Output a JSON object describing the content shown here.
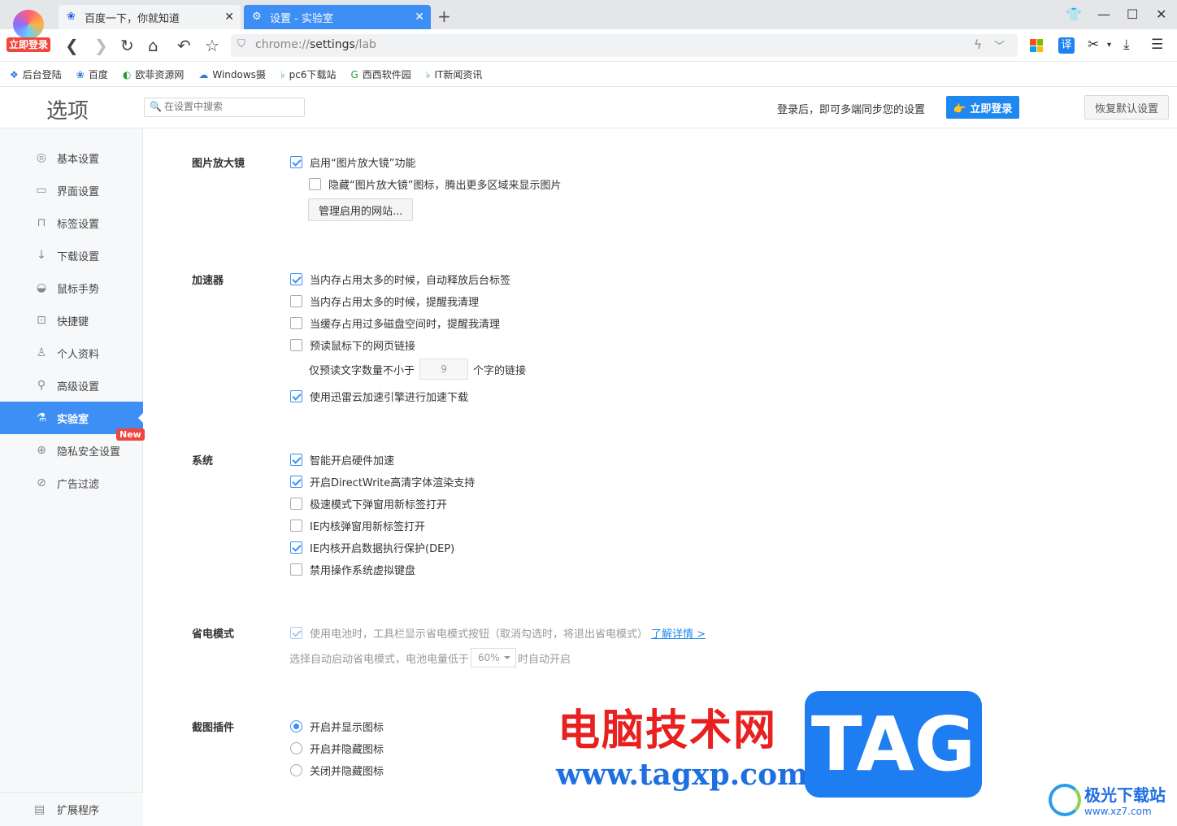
{
  "browser": {
    "login_badge": "立即登录",
    "tabs": [
      {
        "title": "百度一下，你就知道",
        "active": false
      },
      {
        "title": "设置 - 实验室",
        "active": true
      }
    ],
    "address": {
      "scheme": "chrome://",
      "host": "settings",
      "path": "/lab"
    },
    "bookmarks": [
      "后台登陆",
      "百度",
      "欧菲资源网",
      "Windows摄",
      "pc6下载站",
      "西西软件园",
      "IT新闻资讯"
    ],
    "accent_color": "#3d8ef5"
  },
  "header": {
    "title": "选项",
    "search_placeholder": "在设置中搜索",
    "login_hint": "登录后，即可多端同步您的设置",
    "login_button": "立即登录",
    "restore_button": "恢复默认设置"
  },
  "sidebar": {
    "items": [
      {
        "label": "基本设置",
        "icon": "gear-icon"
      },
      {
        "label": "界面设置",
        "icon": "window-icon"
      },
      {
        "label": "标签设置",
        "icon": "tab-icon"
      },
      {
        "label": "下载设置",
        "icon": "download-icon"
      },
      {
        "label": "鼠标手势",
        "icon": "mouse-icon"
      },
      {
        "label": "快捷键",
        "icon": "keyboard-icon"
      },
      {
        "label": "个人资料",
        "icon": "user-icon"
      },
      {
        "label": "高级设置",
        "icon": "wrench-icon"
      },
      {
        "label": "实验室",
        "icon": "flask-icon",
        "active": true
      },
      {
        "label": "隐私安全设置",
        "icon": "shield-icon"
      },
      {
        "label": "广告过滤",
        "icon": "block-icon"
      }
    ],
    "new_badge": "New",
    "extensions": "扩展程序"
  },
  "sections": {
    "magnifier": {
      "title": "图片放大镜",
      "opt1": "启用“图片放大镜”功能",
      "opt2": "隐藏“图片放大镜”图标，腾出更多区域来显示图片",
      "manage_button": "管理启用的网站..."
    },
    "accelerator": {
      "title": "加速器",
      "opt1": "当内存占用太多的时候，自动释放后台标签",
      "opt2": "当内存占用太多的时候，提醒我清理",
      "opt3": "当缓存占用过多磁盘空间时，提醒我清理",
      "opt4": "预读鼠标下的网页链接",
      "prefetch_prefix": "仅预读文字数量不小于",
      "prefetch_value": "9",
      "prefetch_suffix": "个字的链接",
      "opt5": "使用迅雷云加速引擎进行加速下载"
    },
    "system": {
      "title": "系统",
      "opt1": "智能开启硬件加速",
      "opt2": "开启DirectWrite高清字体渲染支持",
      "opt3": "极速模式下弹窗用新标签打开",
      "opt4": "IE内核弹窗用新标签打开",
      "opt5": "IE内核开启数据执行保护(DEP)",
      "opt6": "禁用操作系统虚拟键盘"
    },
    "power": {
      "title": "省电模式",
      "opt1": "使用电池时，工具栏显示省电模式按钮（取消勾选时，将退出省电模式）",
      "link": "了解详情 >",
      "auto_prefix": "选择自动启动省电模式，电池电量低于",
      "auto_value": "60%",
      "auto_suffix": "时自动开启"
    },
    "screenshot": {
      "title": "截图插件",
      "opt1": "开启并显示图标",
      "opt2": "开启并隐藏图标",
      "opt3": "关闭并隐藏图标"
    }
  },
  "watermark": {
    "cn": "电脑技术网",
    "url": "www.tagxp.com",
    "tag": "TAG",
    "site": "极光下载站",
    "site_url": "www.xz7.com"
  }
}
